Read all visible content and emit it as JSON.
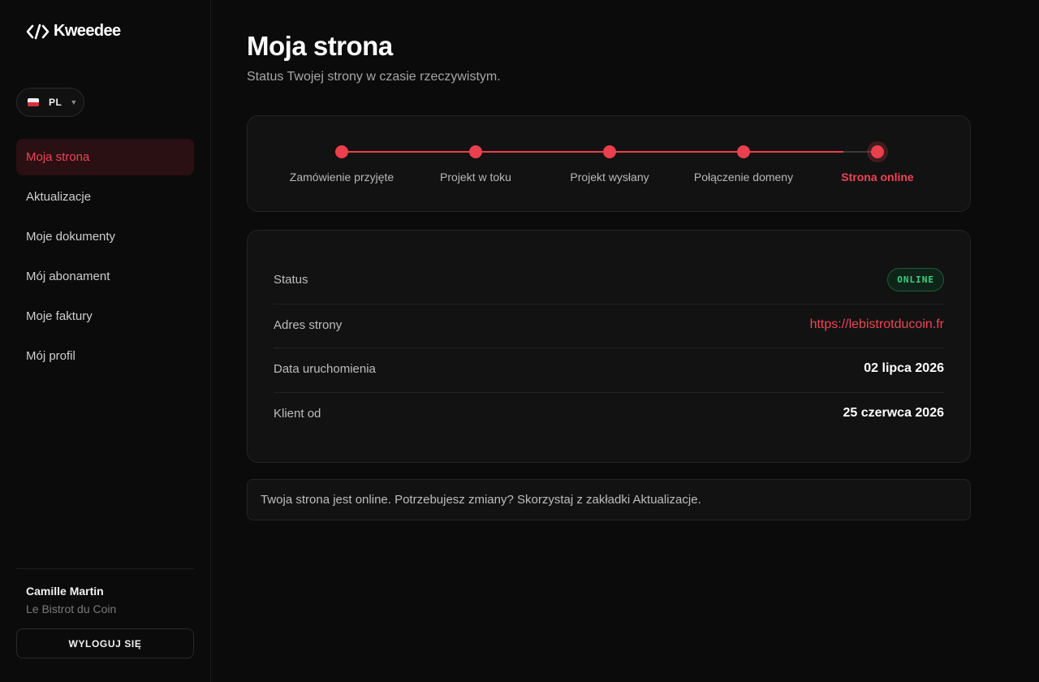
{
  "brand": {
    "name": "Kweedee"
  },
  "language": {
    "code": "PL",
    "flag_icon": "poland-flag-icon"
  },
  "nav": {
    "items": [
      {
        "label": "Moja strona",
        "active": true
      },
      {
        "label": "Aktualizacje",
        "active": false
      },
      {
        "label": "Moje dokumenty",
        "active": false
      },
      {
        "label": "Mój abonament",
        "active": false
      },
      {
        "label": "Moje faktury",
        "active": false
      },
      {
        "label": "Mój profil",
        "active": false
      }
    ]
  },
  "user": {
    "name": "Camille Martin",
    "company": "Le Bistrot du Coin",
    "logout_label": "WYLOGUJ SIĘ"
  },
  "page": {
    "title": "Moja strona",
    "subtitle": "Status Twojej strony w czasie rzeczywistym."
  },
  "progress": {
    "steps": [
      {
        "label": "Zamówienie przyjęte"
      },
      {
        "label": "Projekt w toku"
      },
      {
        "label": "Projekt wysłany"
      },
      {
        "label": "Połączenie domeny"
      },
      {
        "label": "Strona online"
      }
    ],
    "current_step": 5,
    "accent_color": "#ea3f4d"
  },
  "info": {
    "status_label": "Status",
    "status_value": "ONLINE",
    "address_label": "Adres strony",
    "address_value": "https://lebistrotducoin.fr",
    "launch_label": "Data uruchomienia",
    "launch_value": "02 lipca 2026",
    "client_since_label": "Klient od",
    "client_since_value": "25 czerwca 2026"
  },
  "notice": {
    "text": "Twoja strona jest online. Potrzebujesz zmiany? Skorzystaj z zakładki Aktualizacje."
  }
}
